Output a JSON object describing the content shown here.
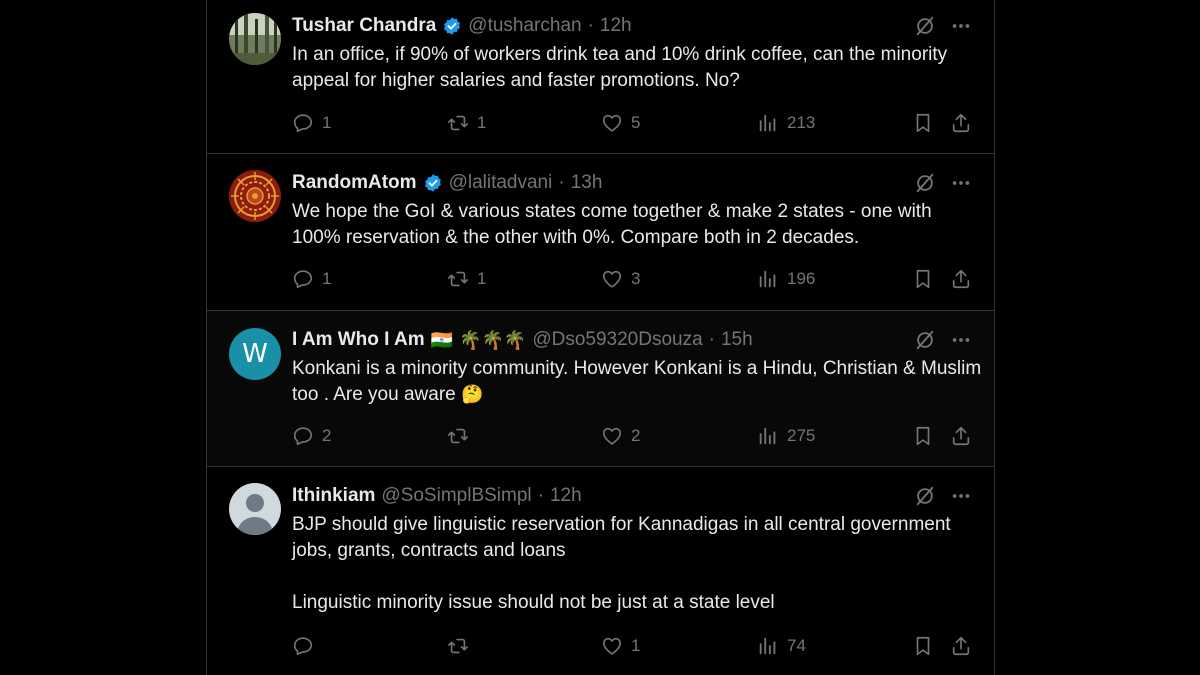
{
  "tweets": [
    {
      "name": "Tushar Chandra",
      "verified": true,
      "handle": "@tusharchan",
      "time": "12h",
      "text": "In an office, if 90% of workers drink tea and 10% drink coffee, can the minority appeal for higher salaries and faster promotions. No?",
      "replies": "1",
      "retweets": "1",
      "likes": "5",
      "views": "213",
      "avatar_colors": [
        "#3b4a2a",
        "#9aa890"
      ]
    },
    {
      "name": "RandomAtom",
      "verified": true,
      "handle": "@lalitadvani",
      "time": "13h",
      "text": "We hope the GoI & various states come together & make 2 states - one with 100% reservation & the other with 0%. Compare both in 2 decades.",
      "replies": "1",
      "retweets": "1",
      "likes": "3",
      "views": "196",
      "avatar_colors": [
        "#8f1a10",
        "#e0a030"
      ]
    },
    {
      "name": "I Am Who I Am",
      "flag": "🇮🇳",
      "name_emoji": "🌴🌴🌴",
      "handle": "@Dso59320Dsouza",
      "time": "15h",
      "text": "Konkani is a minority community. However Konkani is a Hindu, Christian & Muslim too . Are you aware",
      "text_emoji": "🤔",
      "replies": "2",
      "retweets": "",
      "likes": "2",
      "views": "275",
      "avatar_letter": "W",
      "avatar_colors": [
        "#1a8fa8",
        "#ffffff"
      ]
    },
    {
      "name": "Ithinkiam",
      "handle": "@SoSimplBSimpl",
      "time": "12h",
      "text": "BJP should give linguistic reservation for Kannadigas in all central government jobs, grants, contracts and loans\n\nLinguistic minority issue should not be just at a state level",
      "replies": "",
      "retweets": "",
      "likes": "1",
      "views": "74",
      "avatar_colors": [
        "#cfd9de",
        "#6e7b85"
      ]
    }
  ],
  "separator": "·",
  "colors": {
    "background": "#000000",
    "text": "#e7e9ea",
    "muted": "#71767b",
    "divider": "#2f3336",
    "verified": "#1d9bf0"
  },
  "icons": {
    "verified": "verified-badge-icon",
    "grok": "grok-icon",
    "more": "more-icon",
    "reply": "reply-icon",
    "retweet": "retweet-icon",
    "like": "like-icon",
    "views": "views-icon",
    "bookmark": "bookmark-icon",
    "share": "share-icon"
  }
}
